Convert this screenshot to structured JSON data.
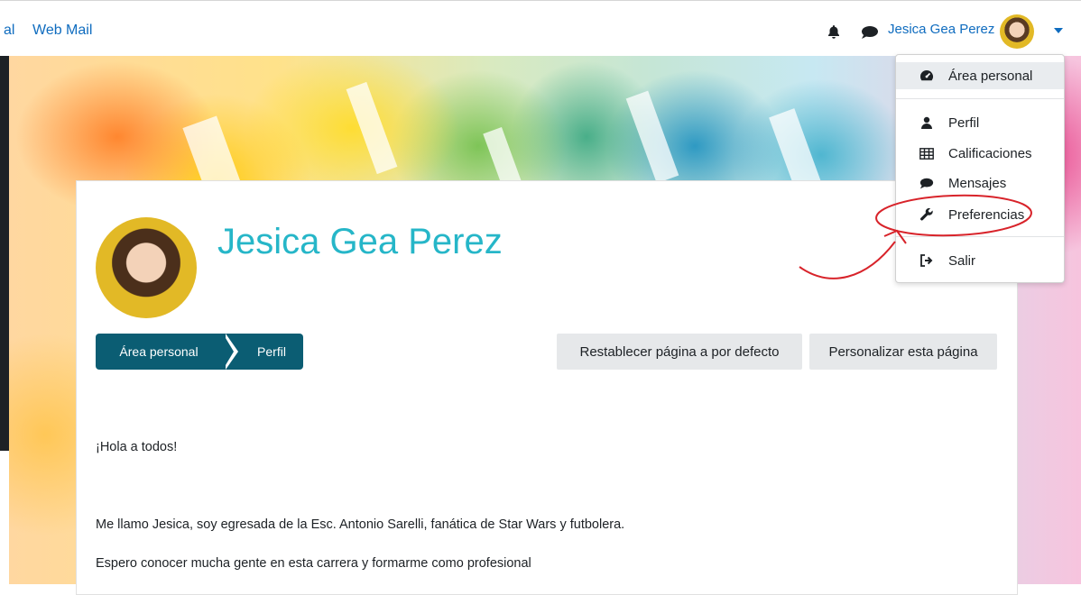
{
  "topbar": {
    "nav_items": [
      "al",
      "Web Mail"
    ],
    "icons": [
      "bell-icon",
      "chat-icon"
    ],
    "user_name": "Jesica Gea Perez"
  },
  "profile": {
    "name": "Jesica Gea Perez",
    "breadcrumb": [
      "Área personal",
      "Perfil"
    ],
    "buttons": {
      "reset": "Restablecer página a por defecto",
      "customize": "Personalizar esta página"
    },
    "description": [
      "¡Hola a todos!",
      "Me llamo Jesica, soy egresada de la Esc. Antonio Sarelli, fanática de Star Wars y futbolera.",
      "Espero conocer mucha gente en esta carrera y formarme como profesional"
    ]
  },
  "user_menu": {
    "items": [
      {
        "label": "Área personal",
        "icon": "dashboard-icon"
      },
      {
        "label": "Perfil",
        "icon": "user-icon"
      },
      {
        "label": "Calificaciones",
        "icon": "table-icon"
      },
      {
        "label": "Mensajes",
        "icon": "chat-icon"
      },
      {
        "label": "Preferencias",
        "icon": "wrench-icon"
      },
      {
        "label": "Salir",
        "icon": "sign-out-icon"
      }
    ]
  },
  "colors": {
    "link": "#0f6cbf",
    "profile_name": "#26b6c8",
    "breadcrumb_bg": "#0b5d73",
    "annotation": "#d8232a"
  }
}
